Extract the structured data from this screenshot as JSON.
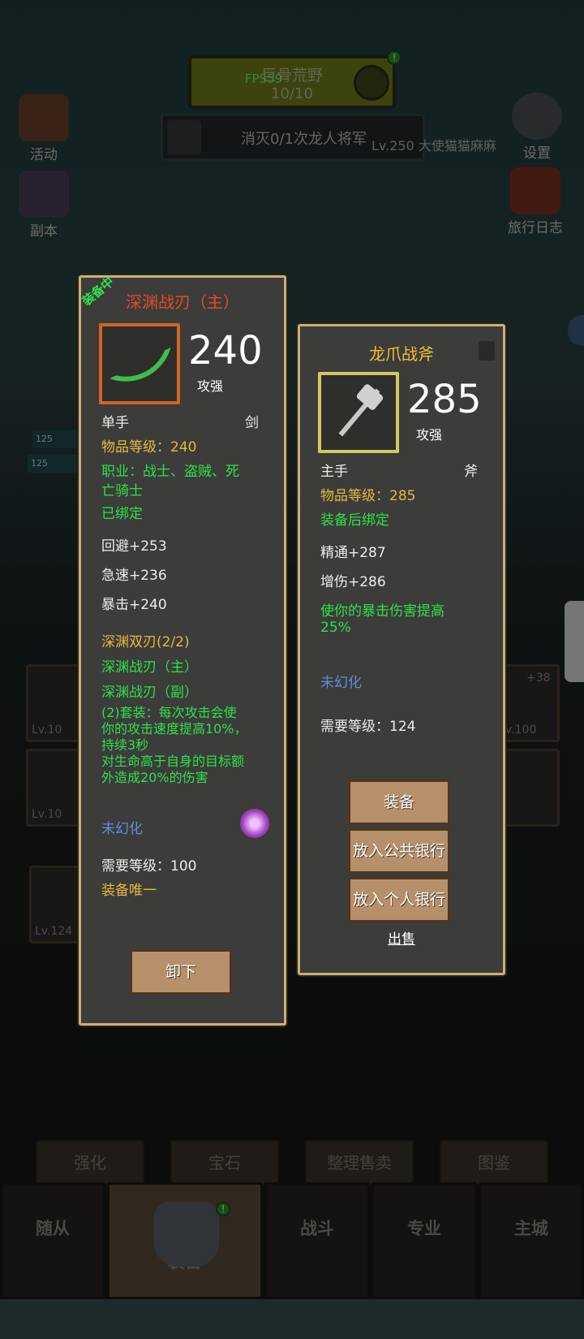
{
  "hud": {
    "zone_name": "巨骨荒野",
    "zone_count": "10/10",
    "fps": "FPS59",
    "quest": "消灭0/1次龙人将军",
    "player_tag": "Lv.250 大使猫猫麻麻",
    "top_left_icon_1": "活动",
    "top_left_icon_2": "副本",
    "top_right_icon_1": "设置",
    "top_right_icon_2": "旅行日志"
  },
  "equipped_item": {
    "status": "装备中",
    "name": "深渊战刃（主）",
    "attack_value": "240",
    "attack_label": "攻强",
    "hand": "单手",
    "weapon_type": "剑",
    "item_level": "物品等级：240",
    "class_line_1": "职业：战士、盗贼、死",
    "class_line_2": "亡骑士",
    "bind": "已绑定",
    "stats": [
      "回避+253",
      "急速+236",
      "暴击+240"
    ],
    "set_name": "深渊双刃(2/2)",
    "set_pieces": [
      "深渊战刃（主）",
      "深渊战刃（副）"
    ],
    "set_bonus_lines": [
      "(2)套装：每次攻击会使",
      "你的攻击速度提高10%，",
      "持续3秒",
      "对生命高于自身的目标额",
      "外造成20%的伤害"
    ],
    "transmog": "未幻化",
    "required_level": "需要等级：100",
    "unique": "装备唯一",
    "unequip_button": "卸下"
  },
  "compare_item": {
    "name": "龙爪战斧",
    "attack_value": "285",
    "attack_label": "攻强",
    "hand": "主手",
    "weapon_type": "斧",
    "item_level": "物品等级：285",
    "bind": "装备后绑定",
    "stats": [
      "精通+287",
      "增伤+286"
    ],
    "effect_line_1": "使你的暴击伤害提高",
    "effect_line_2": "25%",
    "transmog": "未幻化",
    "required_level": "需要等级：124",
    "equip_button": "装备",
    "public_bank_button": "放入公共银行",
    "personal_bank_button": "放入个人银行",
    "sell_link": "出售"
  },
  "background": {
    "left_slot_1": "Lv.10",
    "left_slot_2": "Lv.10",
    "right_slot_plus": "+38",
    "right_slot_lv": "v.100",
    "bag_slot_lv": "Lv.124",
    "bar_values": [
      "125",
      "125"
    ]
  },
  "actions": [
    "强化",
    "宝石",
    "整理售卖",
    "图鉴"
  ],
  "nav": [
    "随从",
    "装备",
    "战斗",
    "专业",
    "主城"
  ],
  "colors": {
    "name_red": "#e04a2c",
    "name_yellow": "#f0c030",
    "green": "#2ee04a",
    "blue": "#5f8ee0",
    "gold": "#e6b83c"
  }
}
